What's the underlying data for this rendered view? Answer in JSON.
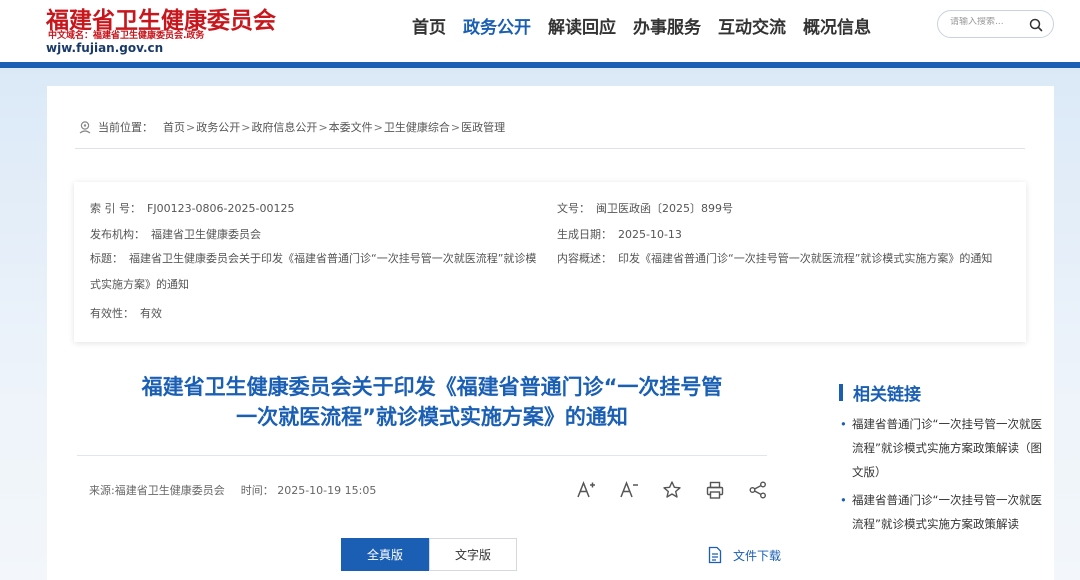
{
  "header": {
    "logo_title": "福建省卫生健康委员会",
    "logo_sub": "中文域名：福建省卫生健康委员会.政务",
    "logo_domain": "wjw.fujian.gov.cn",
    "nav": [
      "首页",
      "政务公开",
      "解读回应",
      "办事服务",
      "互动交流",
      "概况信息"
    ],
    "active_nav": "政务公开",
    "search_placeholder": "请输入搜索..."
  },
  "breadcrumb": {
    "label": "当前位置：",
    "items": [
      "首页",
      "政务公开",
      "政府信息公开",
      "本委文件",
      "卫生健康综合",
      "医政管理"
    ],
    "separator": ">"
  },
  "meta": {
    "index_label": "索 引 号：",
    "index_value": "FJ00123-0806-2025-00125",
    "doc_no_label": "文号：",
    "doc_no_value": "闽卫医政函〔2025〕899号",
    "publisher_label": "发布机构：",
    "publisher_value": "福建省卫生健康委员会",
    "date_label": "生成日期：",
    "date_value": "2025-10-13",
    "title_label": "标题：",
    "title_value": "福建省卫生健康委员会关于印发《福建省普通门诊“一次挂号管一次就医流程”就诊模式实施方案》的通知",
    "summary_label": "内容概述：",
    "summary_value": "印发《福建省普通门诊“一次挂号管一次就医流程”就诊模式实施方案》的通知",
    "validity_label": "有效性：",
    "validity_value": "有效"
  },
  "article": {
    "title_line1": "福建省卫生健康委员会关于印发《福建省普通门诊“一次挂号管",
    "title_line2": "一次就医流程”就诊模式实施方案》的通知",
    "source": "来源:福建省卫生健康委员会",
    "time": "时间：  2025-10-19 15:05",
    "tab_full": "全真版",
    "tab_text": "文字版",
    "download": "文件下载"
  },
  "sidebar": {
    "title": "相关链接",
    "links": [
      "福建省普通门诊“一次挂号管一次就医流程”就诊模式实施方案政策解读（图文版）",
      "福建省普通门诊“一次挂号管一次就医流程”就诊模式实施方案政策解读"
    ]
  },
  "colors": {
    "brand_red": "#c8161d",
    "accent_blue": "#1a5fb4"
  }
}
